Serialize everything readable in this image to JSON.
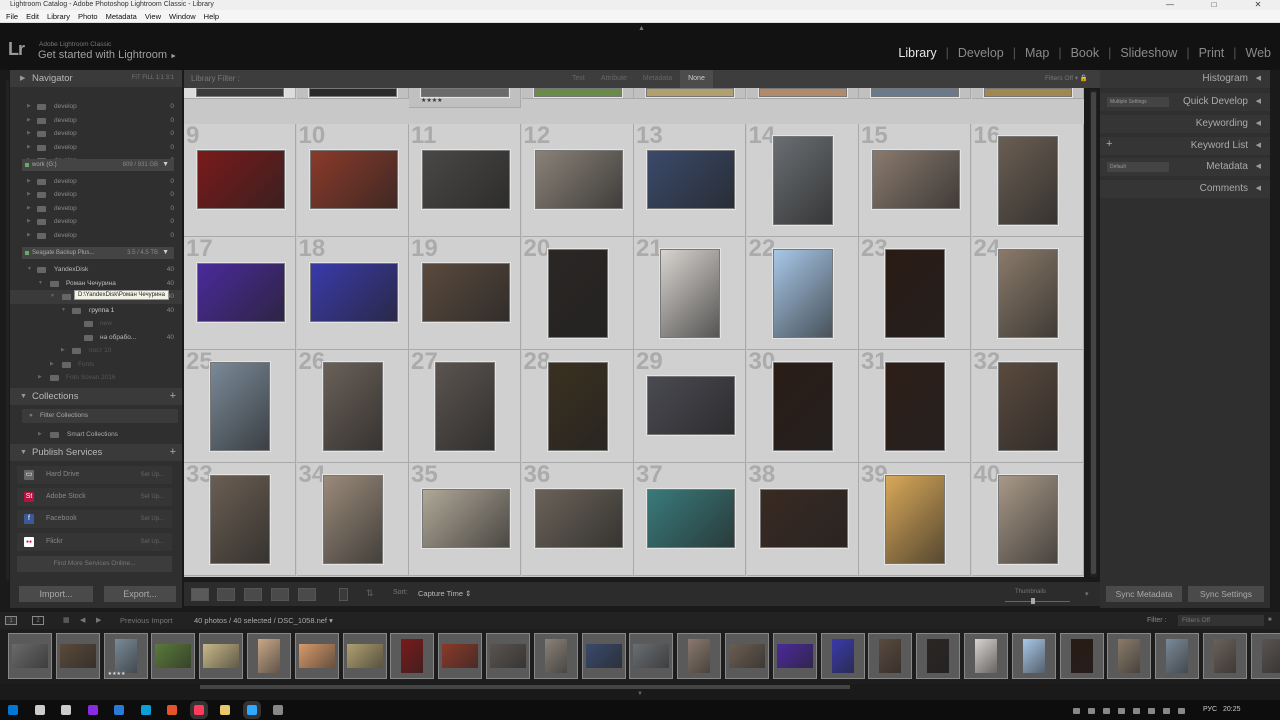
{
  "window": {
    "title": "Lightroom Catalog - Adobe Photoshop Lightroom Classic - Library",
    "controls": [
      "—",
      "□",
      "✕"
    ]
  },
  "menubar": [
    "File",
    "Edit",
    "Library",
    "Photo",
    "Metadata",
    "View",
    "Window",
    "Help"
  ],
  "identity": {
    "logo": "Lr",
    "app": "Adobe Lightroom Classic",
    "title": "Get started with Lightroom",
    "arrow": "►"
  },
  "modules": [
    "Library",
    "Develop",
    "Map",
    "Book",
    "Slideshow",
    "Print",
    "Web"
  ],
  "active_module": "Library",
  "left_panel": {
    "navigator": {
      "label": "Navigator",
      "zoom": "FIT   FILL   1:1   3:1"
    },
    "folders_top": [
      {
        "label": "develop",
        "count": "0"
      },
      {
        "label": "develop",
        "count": "0"
      },
      {
        "label": "develop",
        "count": "0"
      },
      {
        "label": "develop",
        "count": "0"
      },
      {
        "label": "develop",
        "count": "0"
      }
    ],
    "volume_work": {
      "label": "work (G:)",
      "count": "809 / 931 GB"
    },
    "folders_mid": [
      {
        "label": "develop",
        "count": "0"
      },
      {
        "label": "develop",
        "count": "0"
      },
      {
        "label": "develop",
        "count": "0"
      },
      {
        "label": "develop",
        "count": "0"
      },
      {
        "label": "develop",
        "count": "0"
      }
    ],
    "volume_seagate": {
      "label": "Seagate Backup Plus...",
      "count": "3.5 / 4.5 TB"
    },
    "folders_tree": [
      {
        "label": "YandexDisk",
        "count": "40"
      },
      {
        "label": "Роман Чечурина",
        "count": "40"
      },
      {
        "label": "",
        "count": "40"
      },
      {
        "label": "группа 1",
        "count": "40"
      },
      {
        "label": "new",
        "count": ""
      },
      {
        "label": "на обрабо...",
        "count": "40"
      },
      {
        "label": "пост 10",
        "count": ""
      },
      {
        "label": "Fonts",
        "count": ""
      },
      {
        "label": "Foto Sovan 2016",
        "count": ""
      }
    ],
    "tooltip": "D:\\YandexDisk\\Роман Чечурина",
    "collections": {
      "label": "Collections",
      "filter": "Filter Collections",
      "smart": "Smart Collections"
    },
    "publish": {
      "label": "Publish Services",
      "services": [
        {
          "label": "Hard Drive",
          "icon": "hard-drive-icon",
          "glyph": "▭",
          "color": "#666666",
          "setup": "Set Up..."
        },
        {
          "label": "Adobe Stock",
          "icon": "adobe-stock-icon",
          "glyph": "St",
          "color": "#b5123d",
          "setup": "Set Up..."
        },
        {
          "label": "Facebook",
          "icon": "facebook-icon",
          "glyph": "f",
          "color": "#3b5998",
          "setup": "Set Up..."
        },
        {
          "label": "Flickr",
          "icon": "flickr-icon",
          "glyph": "●●",
          "color": "#ffffff",
          "setup": "Set Up..."
        }
      ],
      "find_more": "Find More Services Online..."
    },
    "import": "Import...",
    "export": "Export..."
  },
  "filter_bar": {
    "title": "Library Filter :",
    "options": [
      "Text",
      "Attribute",
      "Metadata",
      "None"
    ],
    "active": "None",
    "status": "Filters Off"
  },
  "grid": {
    "stars_cell_2": "★★★★",
    "cells": [
      {
        "n": "9",
        "c": "#7a1a1a"
      },
      {
        "n": "10",
        "c": "#8a3a2a"
      },
      {
        "n": "11",
        "c": "#4a4846"
      },
      {
        "n": "12",
        "c": "#8a8278"
      },
      {
        "n": "13",
        "c": "#3a4a6a"
      },
      {
        "n": "14",
        "c": "#6a6e72"
      },
      {
        "n": "15",
        "c": "#8a7a6e"
      },
      {
        "n": "16",
        "c": "#6a5e52"
      },
      {
        "n": "17",
        "c": "#4a2a9a"
      },
      {
        "n": "18",
        "c": "#3a3aaa"
      },
      {
        "n": "19",
        "c": "#5a4a3e"
      },
      {
        "n": "20",
        "c": "#2a2624"
      },
      {
        "n": "21",
        "c": "#d8d4d0"
      },
      {
        "n": "22",
        "c": "#a8c8e8"
      },
      {
        "n": "23",
        "c": "#2a1a14"
      },
      {
        "n": "24",
        "c": "#8a7a6a"
      },
      {
        "n": "25",
        "c": "#7a8a98"
      },
      {
        "n": "26",
        "c": "#6a6058"
      },
      {
        "n": "27",
        "c": "#5a5450"
      },
      {
        "n": "28",
        "c": "#3a3020"
      },
      {
        "n": "29",
        "c": "#4a4a52"
      },
      {
        "n": "30",
        "c": "#2a1c16"
      },
      {
        "n": "31",
        "c": "#2e1e18"
      },
      {
        "n": "32",
        "c": "#5a4a3e"
      },
      {
        "n": "33",
        "c": "#6a5e52"
      },
      {
        "n": "34",
        "c": "#9a8a7a"
      },
      {
        "n": "35",
        "c": "#b0a898"
      },
      {
        "n": "36",
        "c": "#6a6258"
      },
      {
        "n": "37",
        "c": "#3a7a7a"
      },
      {
        "n": "38",
        "c": "#3a2a22"
      },
      {
        "n": "39",
        "c": "#d8a858"
      },
      {
        "n": "40",
        "c": "#a89888"
      }
    ],
    "top_row_colors": [
      "#3a3a3a",
      "#2a2a2a",
      "#6a6a6a",
      "#6a8a4a",
      "#b0a070",
      "#b08a6a",
      "#6a7a8a",
      "#a08850"
    ]
  },
  "toolbar": {
    "sort_label": "Sort:",
    "sort_value": "Capture Time ⇕",
    "thumbnails": "Thumbnails"
  },
  "right_panel": {
    "sections": [
      "Histogram",
      "Quick Develop",
      "Keywording",
      "Keyword List",
      "Metadata",
      "Comments"
    ],
    "quick_develop_preset": "Multiple Settings",
    "metadata_preset": "Default",
    "sync_metadata": "Sync Metadata",
    "sync_settings": "Sync Settings"
  },
  "filmstrip_bar": {
    "pages": [
      "1",
      "2"
    ],
    "source": "Previous Import",
    "info": "40 photos / 40 selected / DSC_1058.nef ▾",
    "filter_label": "Filter :",
    "filter_value": "Filters Off"
  },
  "filmstrip": {
    "stars": "★★★★",
    "colors": [
      "#6a6a6a",
      "#5a4a3a",
      "#7a8a98",
      "#5a7a3a",
      "#c8b888",
      "#c8a888",
      "#d89a6a",
      "#b0a070",
      "#7a1a1a",
      "#8a3a2a",
      "#5a5450",
      "#8a8278",
      "#3a4a6a",
      "#6a6e72",
      "#8a7a6e",
      "#6a5e52",
      "#4a2a9a",
      "#3a3aaa",
      "#5a4a3e",
      "#2a2624",
      "#d8d4d0",
      "#a8c8e8",
      "#2a1a14",
      "#8a7a6a",
      "#7a8a98",
      "#6a6058",
      "#5a5450"
    ]
  },
  "taskbar": {
    "lang": "РУС",
    "time": "20:25",
    "icons": [
      "#0078d7",
      "#cccccc",
      "#cccccc",
      "#8a2be2",
      "#2a7ad8",
      "#0aa0d8",
      "#e8542a",
      "#ff3b5c",
      "#e8c86a",
      "#31a8ff",
      "#888888"
    ]
  }
}
